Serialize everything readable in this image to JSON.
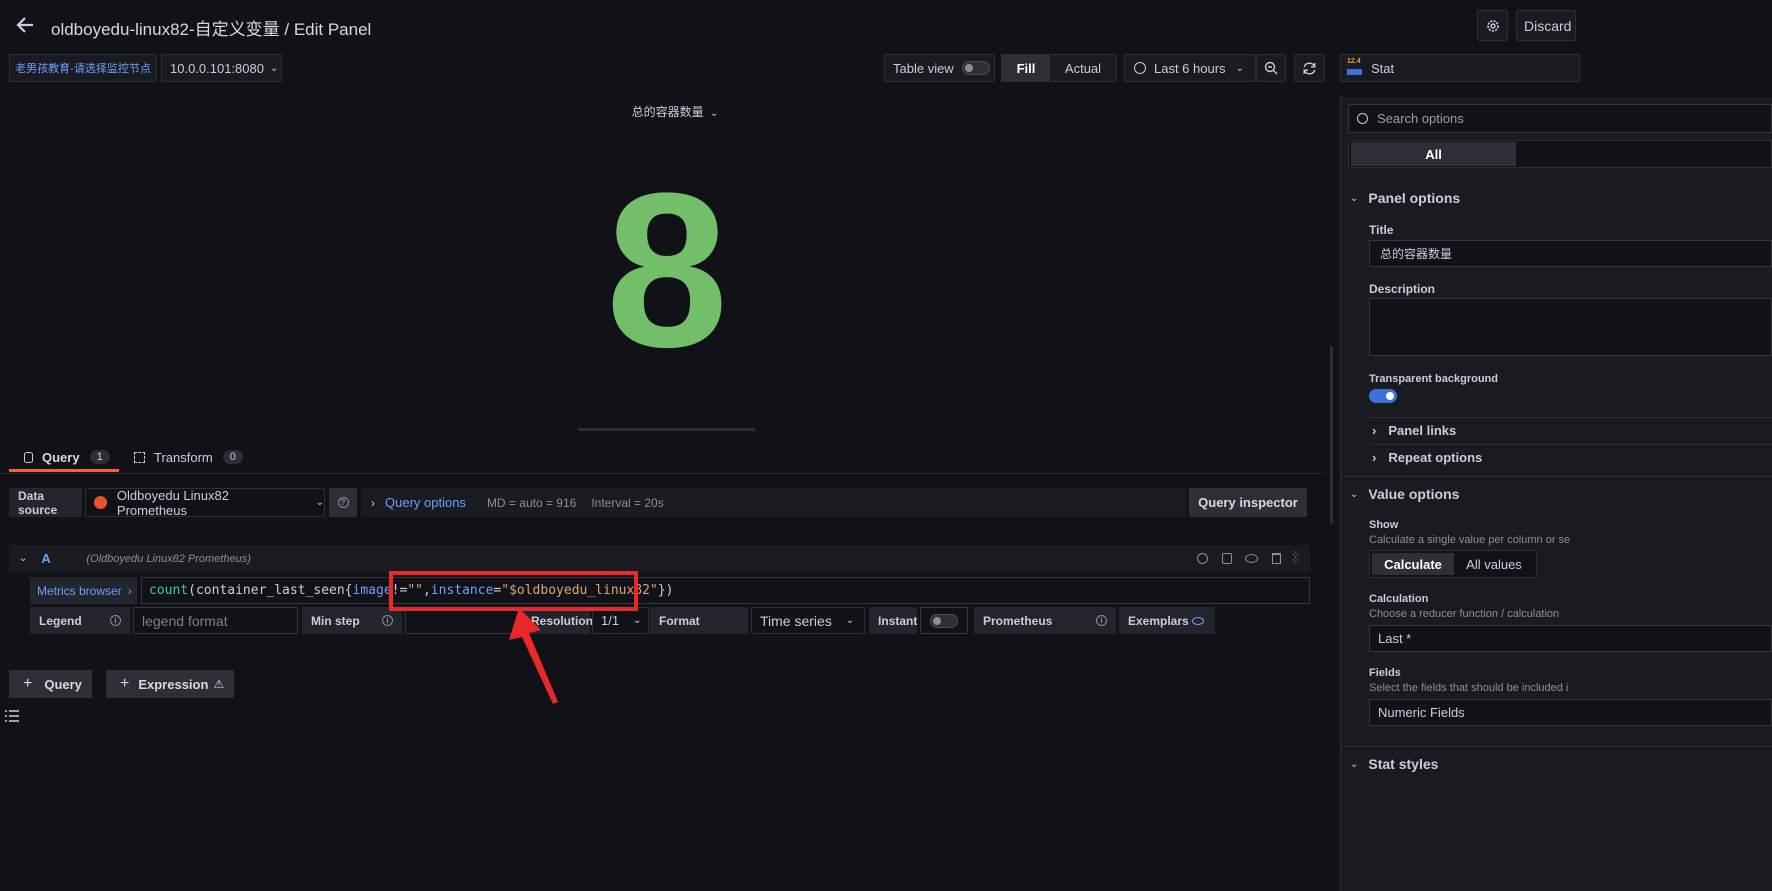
{
  "header": {
    "title": "oldboyedu-linux82-自定义变量 / Edit Panel",
    "discard_label": "Discard"
  },
  "variables": {
    "node_label": "老男孩教育-请选择监控节点",
    "node_value": "10.0.0.101:8080"
  },
  "toolbar": {
    "table_view_label": "Table view",
    "fill_label": "Fill",
    "actual_label": "Actual",
    "time_range_label": "Last 6 hours",
    "viz_type_label": "Stat",
    "viz_type_icon_text": "12.4"
  },
  "panel": {
    "title": "总的容器数量",
    "stat_value": "8",
    "stat_color": "#73bf69"
  },
  "query_tabs": {
    "query_label": "Query",
    "query_count": "1",
    "transform_label": "Transform",
    "transform_count": "0"
  },
  "datasource": {
    "label": "Data source",
    "name": "Oldboyedu Linux82 Prometheus",
    "query_options_label": "Query options",
    "md_text": "MD = auto = 916",
    "interval_text": "Interval = 20s",
    "query_inspector_label": "Query inspector"
  },
  "query_row": {
    "ref_id": "A",
    "ds_name": "(Oldboyedu Linux82 Prometheus)",
    "metrics_browser_label": "Metrics browser",
    "expr_func": "count",
    "expr_open": "(container_last_seen{",
    "expr_label1": "image",
    "expr_op1": "!=",
    "expr_str1": "\"\"",
    "expr_comma": ",",
    "expr_label2": "instance",
    "expr_op2": "=",
    "expr_str2": "\"$oldboyedu_linux82\"",
    "expr_close": "})",
    "legend_label": "Legend",
    "legend_placeholder": "legend format",
    "min_step_label": "Min step",
    "resolution_label": "Resolution",
    "resolution_value": "1/1",
    "format_label": "Format",
    "format_value": "Time series",
    "instant_label": "Instant",
    "prometheus_label": "Prometheus",
    "exemplars_label": "Exemplars"
  },
  "add_buttons": {
    "query_label": "Query",
    "expression_label": "Expression"
  },
  "options_pane": {
    "search_placeholder": "Search options",
    "all_tab_label": "All",
    "panel_options": {
      "section_label": "Panel options",
      "title_label": "Title",
      "title_value": "总的容器数量",
      "description_label": "Description",
      "transparent_label": "Transparent background",
      "panel_links_label": "Panel links",
      "repeat_options_label": "Repeat options"
    },
    "value_options": {
      "section_label": "Value options",
      "show_label": "Show",
      "show_desc": "Calculate a single value per column or se",
      "calculate_label": "Calculate",
      "all_values_label": "All values",
      "calculation_label": "Calculation",
      "calculation_desc": "Choose a reducer function / calculation",
      "calculation_value": "Last *",
      "fields_label": "Fields",
      "fields_desc": "Select the fields that should be included i",
      "fields_value": "Numeric Fields"
    },
    "stat_styles_label": "Stat styles"
  },
  "colors": {
    "accent_blue": "#6e9fff",
    "annotation_red": "#e8282b",
    "stat_green": "#73bf69"
  }
}
